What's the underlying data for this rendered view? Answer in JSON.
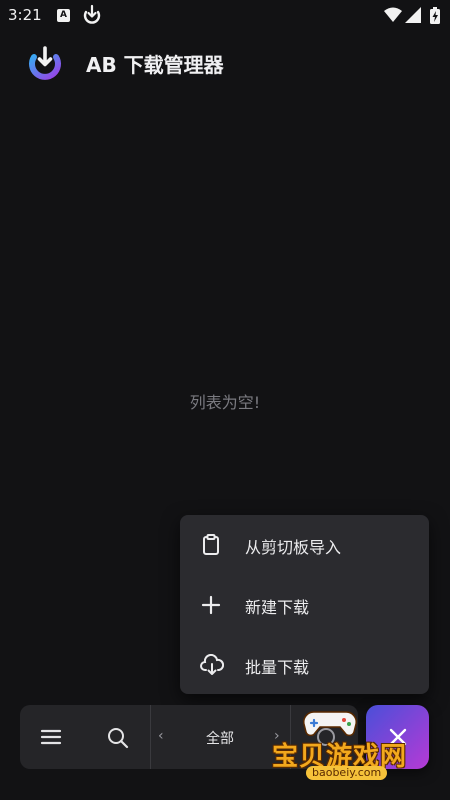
{
  "status_bar": {
    "time": "3:21",
    "notification_icons": [
      "a-badge-icon",
      "download-icon"
    ],
    "system_icons": [
      "wifi-icon",
      "signal-icon",
      "battery-charging-icon"
    ],
    "a_badge_letter": "A"
  },
  "app_bar": {
    "title": "AB 下载管理器",
    "logo_icon": "download-logo-icon"
  },
  "main": {
    "empty_message": "列表为空!"
  },
  "popup_menu": {
    "items": [
      {
        "label": "从剪切板导入",
        "icon": "clipboard-icon"
      },
      {
        "label": "新建下载",
        "icon": "plus-icon"
      },
      {
        "label": "批量下载",
        "icon": "cloud-download-icon"
      }
    ]
  },
  "bottom_bar": {
    "menu_icon": "hamburger-menu-icon",
    "search_icon": "search-icon",
    "prev_symbol": "‹",
    "filter_label": "全部",
    "next_symbol": "›",
    "fab_icon": "close-icon"
  },
  "watermark": {
    "text": "宝贝游戏网",
    "url": "baobeiy.com"
  },
  "colors": {
    "background": "#121214",
    "menu_surface": "#2b2b2f",
    "bottom_bar": "#252528",
    "fab_gradient_start": "#4a4fd8",
    "fab_gradient_end": "#b63ad6",
    "watermark": "#f2a81d"
  }
}
